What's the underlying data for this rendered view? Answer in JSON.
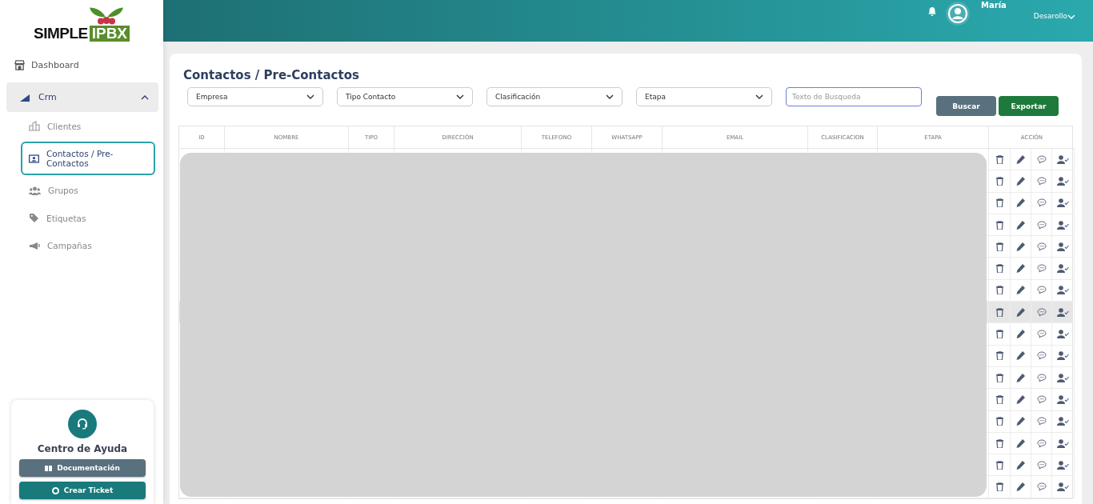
{
  "logo": {
    "left": "SIMPLE",
    "right": "IPBX"
  },
  "header": {
    "user_name": "María",
    "user_role": "Desarollo"
  },
  "sidebar": {
    "items": [
      {
        "label": "Dashboard"
      },
      {
        "label": "Crm",
        "expanded": true,
        "children": [
          {
            "label": "Clientes",
            "selected": false
          },
          {
            "label": "Contactos / Pre-Contactos",
            "selected": true
          },
          {
            "label": "Grupos",
            "selected": false
          },
          {
            "label": "Etiquetas",
            "selected": false
          },
          {
            "label": "Campañas",
            "selected": false
          }
        ]
      }
    ]
  },
  "help": {
    "title": "Centro de Ayuda",
    "buttons": [
      {
        "label": "Documentación",
        "kind": "docs"
      },
      {
        "label": "Crear Ticket",
        "kind": "ticket"
      }
    ]
  },
  "page": {
    "title": "Contactos / Pre-Contactos"
  },
  "filters": [
    {
      "label": "Empresa"
    },
    {
      "label": "Tipo Contacto"
    },
    {
      "label": "Clasificación"
    },
    {
      "label": "Etapa"
    }
  ],
  "search": {
    "placeholder": "Texto de Busqueda"
  },
  "buttons": [
    {
      "label": "Buscar",
      "kind": "search"
    },
    {
      "label": "Exportar",
      "kind": "export"
    }
  ],
  "table": {
    "columns": [
      "ID",
      "NOMBRE",
      "TIPO",
      "DIRECCIÓN",
      "TELEFONO",
      "WHATSAPP",
      "EMAIL",
      "CLASIFICACION",
      "ETAPA",
      "ACCIÓN"
    ],
    "rows": [
      {
        "highlighted": false
      },
      {
        "highlighted": false
      },
      {
        "highlighted": false
      },
      {
        "highlighted": false
      },
      {
        "highlighted": false
      },
      {
        "highlighted": false
      },
      {
        "highlighted": false
      },
      {
        "highlighted": true
      },
      {
        "highlighted": false
      },
      {
        "highlighted": false
      },
      {
        "highlighted": false
      },
      {
        "highlighted": false
      },
      {
        "highlighted": false
      },
      {
        "highlighted": false
      },
      {
        "highlighted": false
      },
      {
        "highlighted": false
      }
    ]
  }
}
